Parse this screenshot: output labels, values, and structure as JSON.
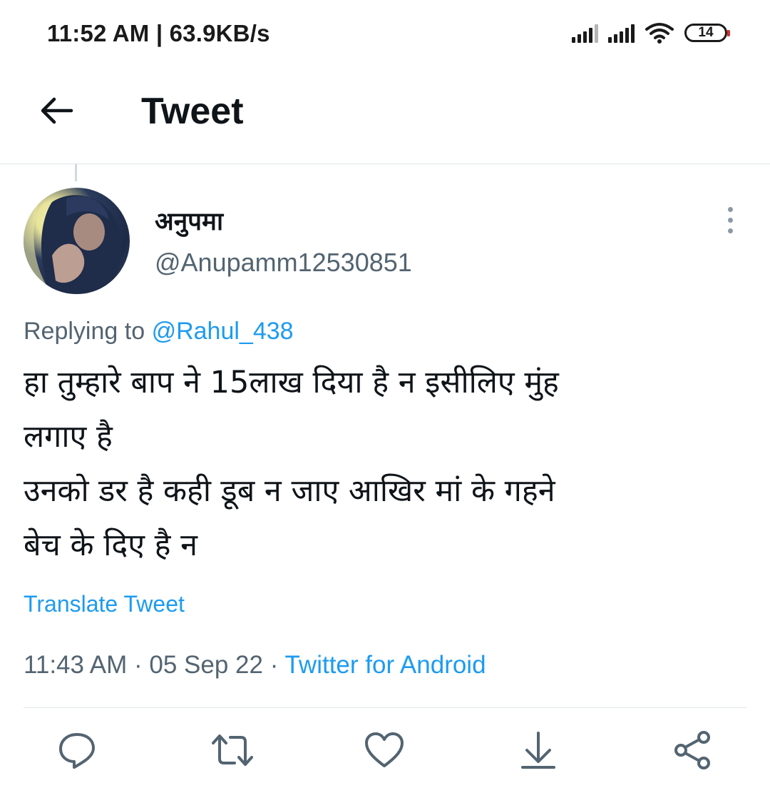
{
  "status_bar": {
    "time": "11:52 AM | 63.9KB/s",
    "battery": "14",
    "icons": [
      "signal-icon",
      "signal-icon",
      "wifi-icon",
      "battery-icon"
    ]
  },
  "header": {
    "title": "Tweet",
    "back_icon": "back-arrow-icon"
  },
  "tweet": {
    "display_name": "अनुपमा",
    "handle": "@Anupamm12530851",
    "replying_label": "Replying to",
    "replying_to": "@Rahul_438",
    "text": "हा तुम्हारे बाप ने 15लाख दिया है न इसीलिए मुंह\nलगाए है\nउनको डर है कही डूब न जाए आखिर मां के गहने\nबेच के दिए है न",
    "translate_label": "Translate Tweet",
    "time": "11:43 AM",
    "date": "05 Sep 22",
    "separator": "·",
    "source": "Twitter for Android"
  },
  "actions": [
    "reply-icon",
    "retweet-icon",
    "like-icon",
    "download-icon",
    "share-icon"
  ],
  "colors": {
    "accent": "#1d9bf0",
    "secondary_text": "#536471",
    "primary_text": "#0f1419"
  }
}
